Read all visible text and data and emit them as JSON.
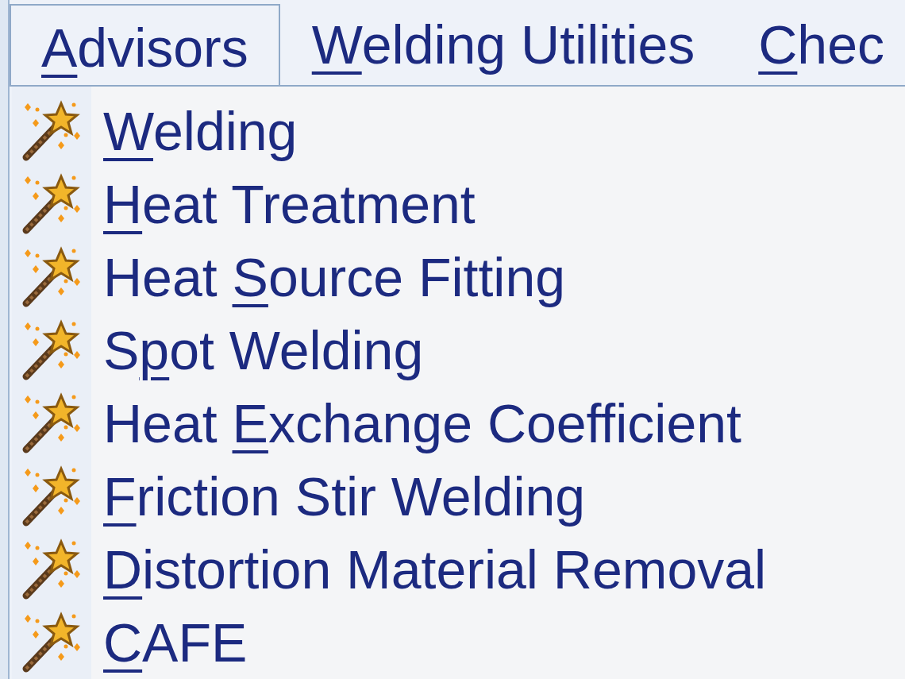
{
  "menu_bar": [
    {
      "key": "A",
      "post": "dvisors",
      "selected": true
    },
    {
      "key": "W",
      "post": "elding Utilities",
      "selected": false
    },
    {
      "key": "C",
      "post": "hec",
      "selected": false
    }
  ],
  "menu_items": [
    {
      "key": "W",
      "post": "elding"
    },
    {
      "key": "H",
      "post": "eat Treatment"
    },
    {
      "pre": "Heat ",
      "key": "S",
      "post": "ource Fitting"
    },
    {
      "pre": "S",
      "key": "p",
      "post": "ot Welding"
    },
    {
      "pre": "Heat ",
      "key": "E",
      "post": "xchange Coefficient"
    },
    {
      "key": "F",
      "post": "riction Stir Welding"
    },
    {
      "key": "D",
      "post": "istortion Material Removal"
    },
    {
      "key": "C",
      "post": "AFE"
    }
  ]
}
